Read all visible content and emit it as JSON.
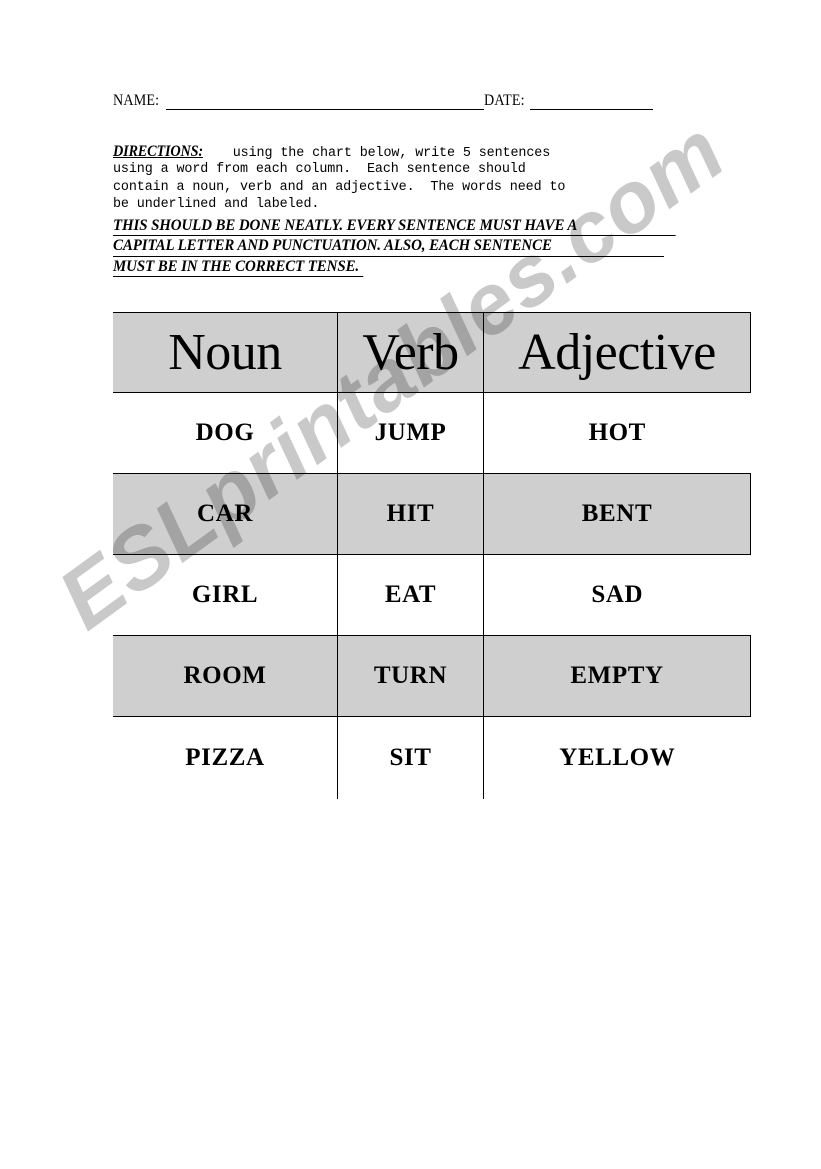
{
  "page": {
    "background_color": "#ffffff",
    "text_color": "#000000"
  },
  "header_fields": {
    "name_label": "NAME:",
    "date_label": "DATE:"
  },
  "directions": {
    "heading": "DIRECTIONS:",
    "line1": "using the chart below, write 5 sentences",
    "body": "using a word from each column.  Each sentence should\ncontain a noun, verb and an adjective.  The words need to\nbe underlined and labeled.",
    "emphasis": [
      "THIS SHOULD BE DONE NEATLY.  EVERY SENTENCE MUST HAVE A",
      "CAPITAL LETTER AND PUNCTUATION.  ALSO, EACH SENTENCE",
      "MUST BE IN THE CORRECT TENSE."
    ]
  },
  "word_table": {
    "header_fill": "#cfcfcf",
    "row_fill_alt": "#cfcfcf",
    "columns": [
      "Noun",
      "Verb",
      "Adjective"
    ],
    "rows": [
      {
        "noun": "DOG",
        "verb": "JUMP",
        "adjective": "HOT",
        "shaded": false
      },
      {
        "noun": "CAR",
        "verb": "HIT",
        "adjective": "BENT",
        "shaded": true
      },
      {
        "noun": "GIRL",
        "verb": "EAT",
        "adjective": "SAD",
        "shaded": false
      },
      {
        "noun": "ROOM",
        "verb": "TURN",
        "adjective": "EMPTY",
        "shaded": true
      },
      {
        "noun": "PIZZA",
        "verb": "SIT",
        "adjective": "YELLOW",
        "shaded": false
      }
    ]
  },
  "watermark": {
    "text": "ESLprintables.com",
    "color": "#c9c9c9"
  }
}
